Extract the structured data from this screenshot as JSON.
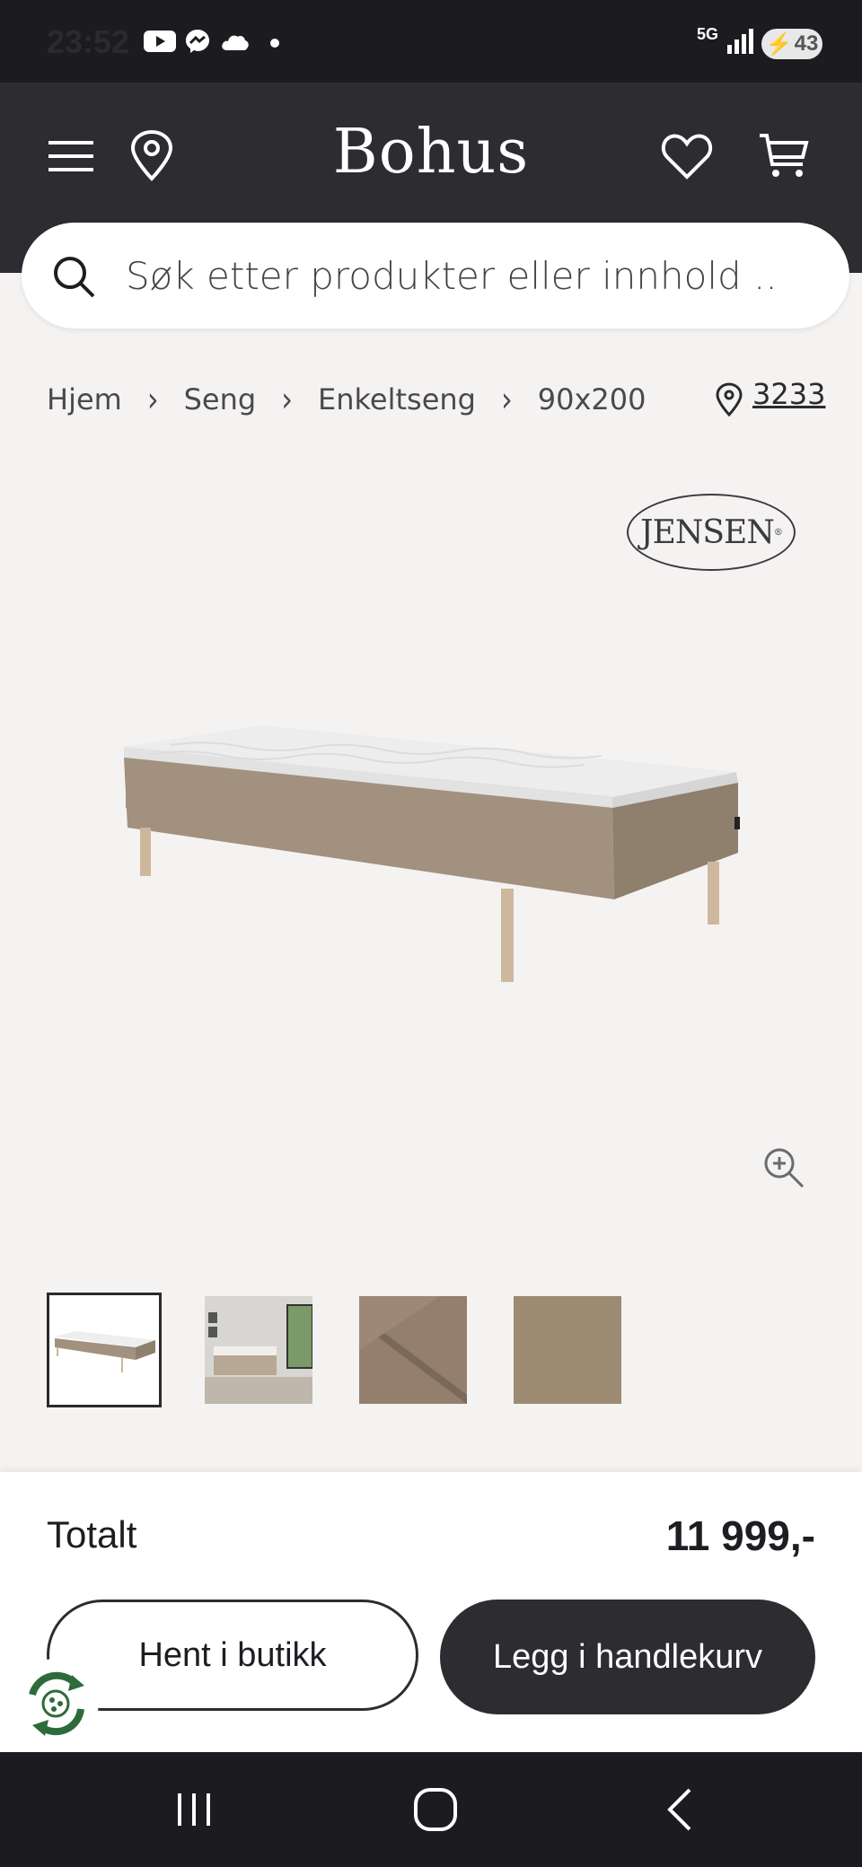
{
  "status_bar": {
    "time": "23:52",
    "network": "5G",
    "battery": "43",
    "icons": [
      "youtube-icon",
      "messenger-icon",
      "cloud-icon",
      "dot-icon",
      "signal-icon",
      "battery-charging-icon"
    ]
  },
  "header": {
    "logo": "Bohus",
    "icons": [
      "menu-icon",
      "location-pin-icon",
      "heart-icon",
      "cart-icon"
    ]
  },
  "search": {
    "placeholder": "Søk etter produkter eller innhold .."
  },
  "breadcrumb": {
    "items": [
      "Hjem",
      "Seng",
      "Enkeltseng",
      "90x200"
    ],
    "store": "3233"
  },
  "product": {
    "brand": "JENSEN",
    "thumbnails": [
      "bed-product-thumb",
      "bedroom-scene-thumb",
      "fabric-fold-thumb",
      "fabric-swatch-thumb"
    ],
    "colors": {
      "fabric": "#a2917f",
      "legs": "#cdb79d",
      "mattress": "#eeeeee"
    }
  },
  "purchase": {
    "total_label": "Totalt",
    "total_price": "11 999,-",
    "pickup_label": "Hent i butikk",
    "cart_label": "Legg i handlekurv"
  },
  "theme": {
    "header_bg": "#2d2c31",
    "page_bg": "#f5f3f1",
    "eco_green": "#2e6b3a"
  }
}
